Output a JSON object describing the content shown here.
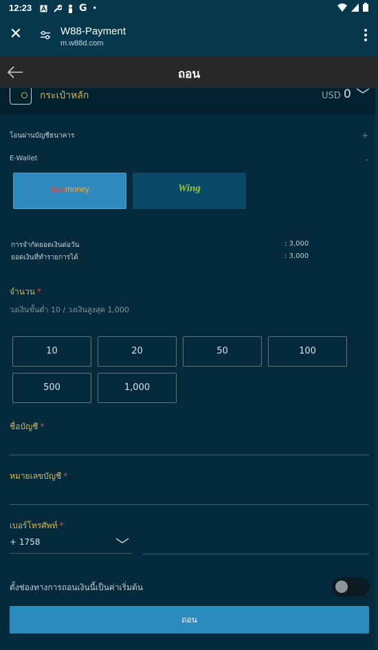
{
  "status_bar": {
    "time": "12:23",
    "icons": [
      "a-icon",
      "wrench-icon",
      "person-icon",
      "G",
      "•"
    ]
  },
  "browser": {
    "title": "W88-Payment",
    "url": "m.w88d.com"
  },
  "header": {
    "title": "ถอน"
  },
  "wallet": {
    "name": "กระเป๋าหลัก",
    "currency": "USD",
    "balance": "0"
  },
  "methods": {
    "bank_transfer": {
      "label": "โอนผ่านบัญชีธนาคาร",
      "sign": "+"
    },
    "ewallet": {
      "label": "E-Wallet",
      "sign": "-"
    },
    "options": [
      {
        "name": "truemoney",
        "logo_a": "true",
        "logo_b": "money",
        "selected": true
      },
      {
        "name": "Wing",
        "logo": "Wing",
        "selected": false
      }
    ]
  },
  "limits": {
    "daily_label": "การจำกัดยอดเงินต่อวัน",
    "daily_value": ": 3,000",
    "available_label": "ยอดเงินที่ทำรายการได้",
    "available_value": ": 3,000"
  },
  "amount": {
    "label": "จำนวน",
    "required": "*",
    "hint": "วงเงินขั้นต่ำ 10 / วงเงินสูงสุด 1,000",
    "quick": [
      "10",
      "20",
      "50",
      "100",
      "500",
      "1,000"
    ]
  },
  "account_name": {
    "label": "ชื่อบัญชี",
    "required": "*"
  },
  "account_number": {
    "label": "หมายเลขบัญชี",
    "required": "*"
  },
  "phone": {
    "label": "เบอร์โทรศัพท์",
    "required": "*",
    "code": "+ 1758"
  },
  "default_setting": {
    "label": "ตั้งช่องทางการถอนเงินนี้เป็นค่าเริ่มต้น",
    "enabled": false
  },
  "submit_label": "ถอน",
  "colors": {
    "accent": "#2b8bbc",
    "gold": "#d6b85a",
    "background": "#042a3c"
  }
}
